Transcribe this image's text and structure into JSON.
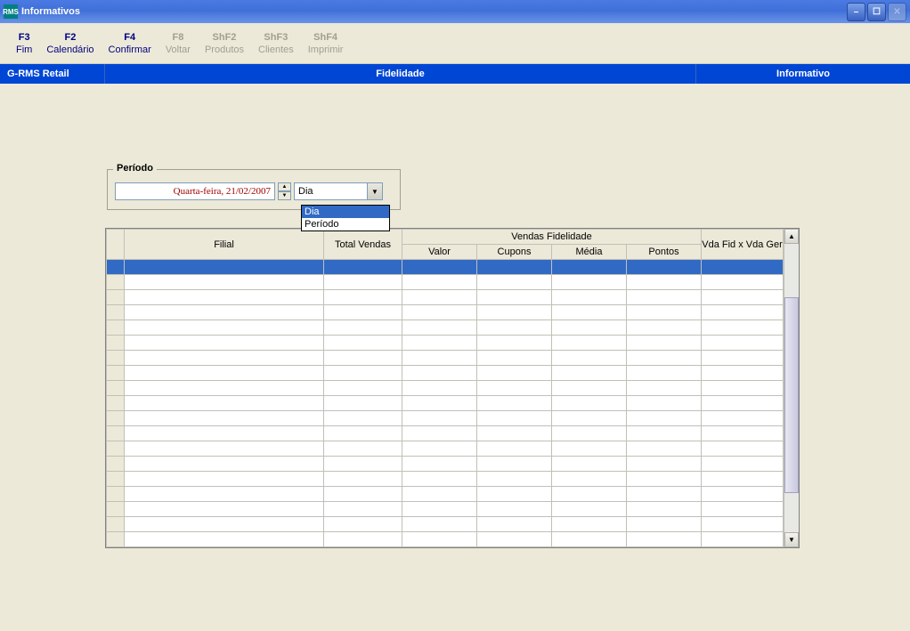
{
  "window": {
    "title": "Informativos",
    "icon_text": "RMS"
  },
  "toolbar": [
    {
      "shortcut": "F3",
      "label": "Fim",
      "enabled": true
    },
    {
      "shortcut": "F2",
      "label": "Calendário",
      "enabled": true
    },
    {
      "shortcut": "F4",
      "label": "Confirmar",
      "enabled": true
    },
    {
      "shortcut": "F8",
      "label": "Voltar",
      "enabled": false
    },
    {
      "shortcut": "ShF2",
      "label": "Produtos",
      "enabled": false
    },
    {
      "shortcut": "ShF3",
      "label": "Clientes",
      "enabled": false
    },
    {
      "shortcut": "ShF4",
      "label": "Imprimir",
      "enabled": false
    }
  ],
  "bluebar": {
    "left": "G-RMS Retail",
    "center": "Fidelidade",
    "right": "Informativo"
  },
  "periodo": {
    "legend": "Período",
    "date_value": "Quarta-feira, 21/02/2007",
    "combo_value": "Dia",
    "options": [
      "Dia",
      "Período"
    ],
    "selected_option_index": 0
  },
  "grid": {
    "headers": {
      "filial": "Filial",
      "total_vendas": "Total Vendas",
      "vendas_fidelidade": "Vendas Fidelidade",
      "valor": "Valor",
      "cupons": "Cupons",
      "media": "Média",
      "pontos": "Pontos",
      "vda_fid_ger": "Vda Fid x Vda Ger"
    },
    "rows": []
  }
}
